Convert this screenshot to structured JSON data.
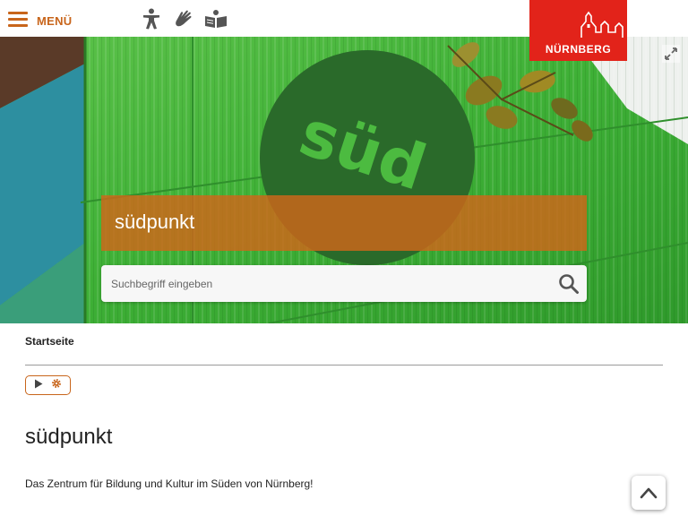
{
  "header": {
    "menu_label": "MENÜ",
    "accessibility_icons": [
      "accessibility-person-icon",
      "sign-language-icon",
      "easy-reading-icon"
    ],
    "logo_text": "NÜRNBERG",
    "accent_color": "#c8651b",
    "logo_color": "#e2231a"
  },
  "hero": {
    "title": "südpunkt",
    "image_text": "süd",
    "expand_icon": "expand-icon",
    "search": {
      "placeholder": "Suchbegriff eingeben",
      "value": "",
      "icon": "search-icon"
    }
  },
  "breadcrumb": "Startseite",
  "player_icons": [
    "play-icon",
    "gear-icon"
  ],
  "main": {
    "title": "südpunkt",
    "lead": "Das Zentrum für Bildung und Kultur im Süden von Nürnberg!"
  },
  "back_to_top_icon": "chevron-up-icon"
}
